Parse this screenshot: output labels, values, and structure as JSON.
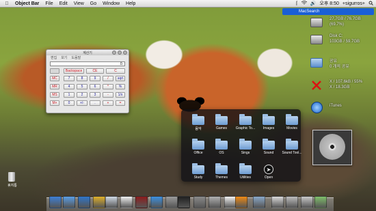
{
  "menubar": {
    "app": "Object Bar",
    "items": [
      "File",
      "Edit",
      "View",
      "Go",
      "Window",
      "Help"
    ],
    "clock": "오후 8:50",
    "user": "+sigurros+"
  },
  "search": {
    "label": "MacSearch"
  },
  "drives": [
    {
      "line1": "27.7GB / 76.7GB",
      "line2": "(69.7%)"
    },
    {
      "line1": "Disk C:",
      "line2": "103GB / 59.7GB"
    },
    {
      "line1": "공유",
      "line2": "0 개의 공유"
    },
    {
      "line1": "X / 107.6kB / 55%",
      "line2": "X / 18.3GB"
    }
  ],
  "itunes_label": "iTunes",
  "calculator": {
    "title": "계산기",
    "menu": [
      "편집",
      "보기",
      "도움말"
    ],
    "display": "0.",
    "top_buttons": [
      "Backspace",
      "CE",
      "C"
    ],
    "rows": [
      [
        "MC",
        "7",
        "8",
        "9",
        "/",
        "sqrt"
      ],
      [
        "MR",
        "4",
        "5",
        "6",
        "*",
        "%"
      ],
      [
        "MS",
        "1",
        "2",
        "3",
        "-",
        "1/x"
      ],
      [
        "M+",
        "0",
        "+/-",
        ".",
        "+",
        "="
      ]
    ]
  },
  "stack": {
    "items": [
      "음악",
      "Games",
      "Graphic To...",
      "Images",
      "Movies",
      "Office",
      "OS",
      "Sings",
      "Sound",
      "Sound Tool...",
      "Study",
      "Themes",
      "Utilities",
      "Open"
    ]
  },
  "desktop": {
    "trash_label": "휴지통"
  },
  "colors": {
    "search_bg": "#1a5fd6",
    "stack_bg": "#0f0f14",
    "calc_red": "#c8141e",
    "calc_blue": "#1a1a9a"
  }
}
